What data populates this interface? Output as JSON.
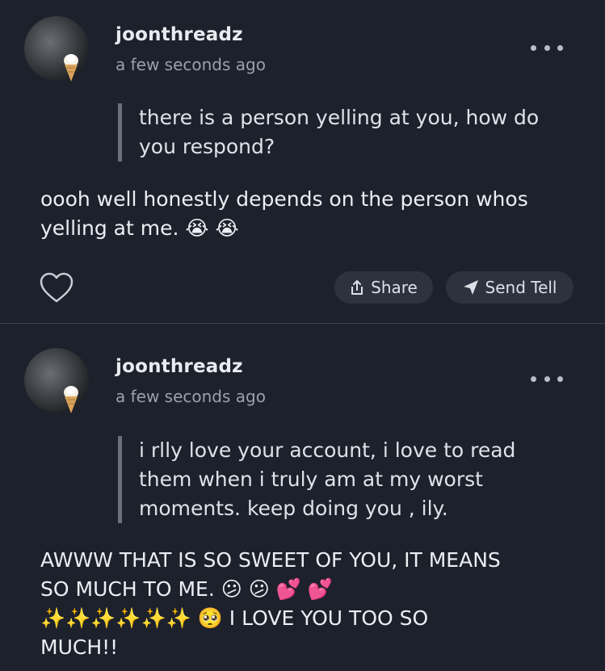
{
  "posts": [
    {
      "username": "joonthreadz",
      "timestamp": "a few seconds ago",
      "question_lines": [
        "there is a person yelling at you, how do",
        "you respond?"
      ],
      "answer_lines": [
        "oooh well honestly depends on the person whos",
        "yelling at me. 😭 😭"
      ],
      "actions": {
        "share_label": "Share",
        "send_tell_label": "Send Tell"
      }
    },
    {
      "username": "joonthreadz",
      "timestamp": "a few seconds ago",
      "question_lines": [
        "i rlly love your account, i love to read",
        "them when i truly am at my worst",
        "moments. keep doing you , ily."
      ],
      "answer_lines": [
        "AWWW THAT IS SO SWEET OF YOU, IT MEANS",
        "SO MUCH TO ME. 😕 😕 💕 💕",
        "✨✨✨✨✨✨ 🥺  I LOVE YOU TOO SO",
        "MUCH!!"
      ]
    }
  ],
  "icons": {
    "more": "more-horizontal-icon",
    "heart": "heart-outline-icon",
    "share": "share-icon",
    "send": "send-arrow-icon"
  },
  "colors": {
    "background": "#1d212c",
    "pill": "#2d323e",
    "quote_bar": "#6b707d",
    "muted_text": "#9aa0ad"
  }
}
